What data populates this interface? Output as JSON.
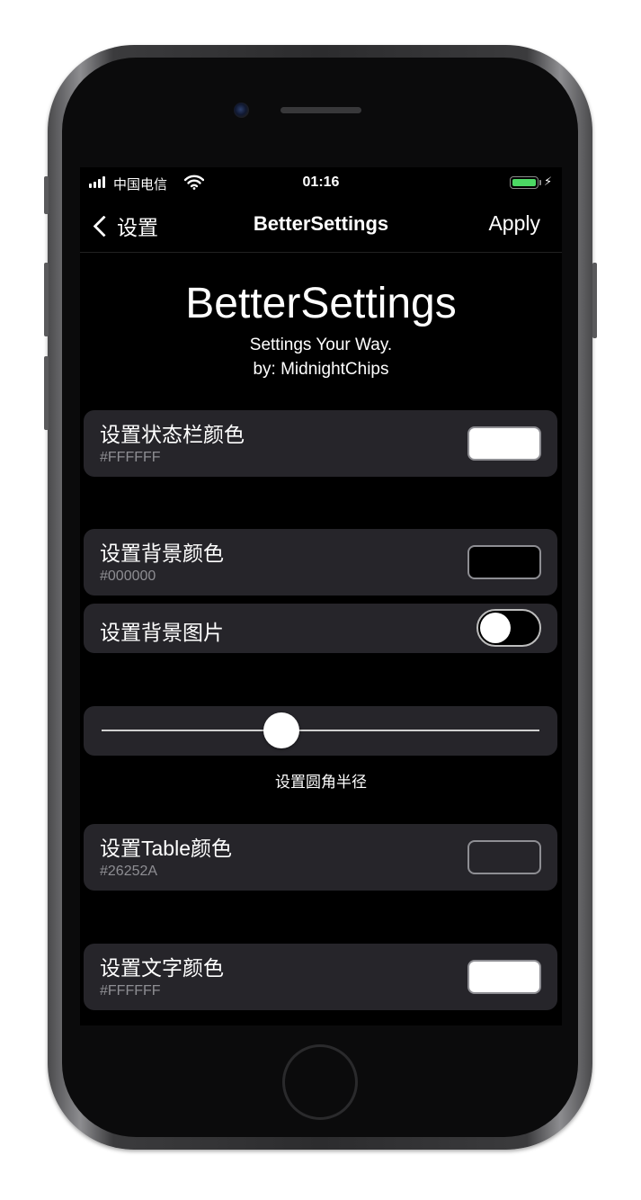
{
  "status_bar": {
    "carrier": "中国电信",
    "time": "01:16",
    "battery_color": "#4cd964"
  },
  "nav": {
    "back_label": "设置",
    "title": "BetterSettings",
    "apply_label": "Apply"
  },
  "header": {
    "title": "BetterSettings",
    "subtitle_line1": "Settings Your Way.",
    "subtitle_line2": "by: MidnightChips"
  },
  "settings": {
    "status_bar_color": {
      "label": "设置状态栏颜色",
      "value": "#FFFFFF"
    },
    "background_color": {
      "label": "设置背景颜色",
      "value": "#000000"
    },
    "background_image": {
      "label": "设置背景图片",
      "enabled": false
    },
    "corner_radius": {
      "label": "设置圆角半径",
      "level": 0.41
    },
    "table_color": {
      "label": "设置Table颜色",
      "value": "#26252A"
    },
    "text_color": {
      "label": "设置文字颜色",
      "value": "#FFFFFF"
    }
  },
  "icons": {
    "signal": "signal-bars-icon",
    "wifi": "wifi-icon",
    "battery": "battery-icon",
    "charging": "charging-bolt-icon",
    "back": "chevron-left-icon"
  }
}
